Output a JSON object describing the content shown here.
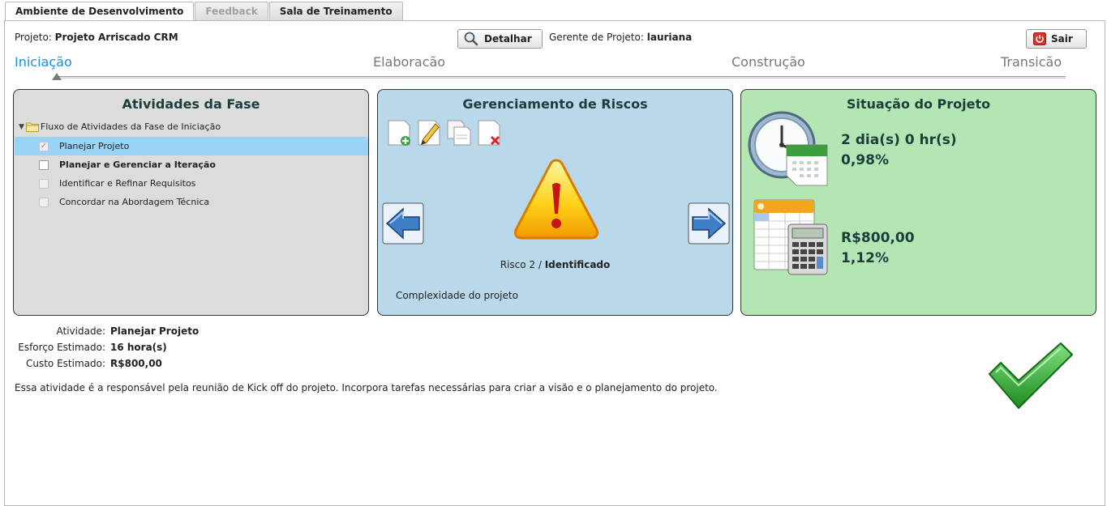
{
  "tabs": [
    {
      "label": "Ambiente de Desenvolvimento",
      "state": "active"
    },
    {
      "label": "Feedback",
      "state": "disabled"
    },
    {
      "label": "Sala de Treinamento",
      "state": "normal"
    }
  ],
  "header": {
    "project_label": "Projeto:",
    "project_name": "Projeto Arriscado CRM",
    "details_button": "Detalhar",
    "manager_label": "Gerente de Projeto:",
    "manager_name": "lauriana",
    "exit_button": "Sair"
  },
  "phases": [
    {
      "label": "Iniciação",
      "active": true
    },
    {
      "label": "Elaboracão",
      "active": false
    },
    {
      "label": "Construção",
      "active": false
    },
    {
      "label": "Transicão",
      "active": false
    }
  ],
  "activities_panel": {
    "title": "Atividades da Fase",
    "root": "Fluxo de Atividades da Fase de Iniciação",
    "items": [
      {
        "label": "Planejar Projeto",
        "checked": true,
        "selected": true,
        "bold": false
      },
      {
        "label": "Planejar e Gerenciar a Iteração",
        "checked": false,
        "selected": false,
        "bold": true
      },
      {
        "label": "Identificar e Refinar Requisitos",
        "checked": false,
        "selected": false,
        "bold": false
      },
      {
        "label": "Concordar na Abordagem Técnica",
        "checked": false,
        "selected": false,
        "bold": false
      }
    ]
  },
  "risks_panel": {
    "title": "Gerenciamento de Riscos",
    "risk_name": "Risco 2 / ",
    "risk_status": "Identificado",
    "risk_description": "Complexidade do projeto"
  },
  "status_panel": {
    "title": "Situação do Projeto",
    "time": "2 dia(s) 0 hr(s)",
    "time_percent": "0,98%",
    "cost": "R$800,00",
    "cost_percent": "1,12%"
  },
  "details": {
    "activity_label": "Atividade:",
    "activity_value": "Planejar Projeto",
    "effort_label": "Esforço Estimado:",
    "effort_value": "16 hora(s)",
    "cost_label": "Custo Estimado:",
    "cost_value": "R$800,00",
    "description": "Essa atividade é a responsável pela reunião de Kick off do projeto. Incorpora tarefas necessárias para criar a visão e o planejamento do projeto."
  },
  "colors": {
    "phase_active": "#1e8fd6",
    "activities_bg": "#dcdcdc",
    "risks_bg": "#b9d8ea",
    "status_bg": "#b4e6b4",
    "selected_row": "#9bd3f7"
  }
}
